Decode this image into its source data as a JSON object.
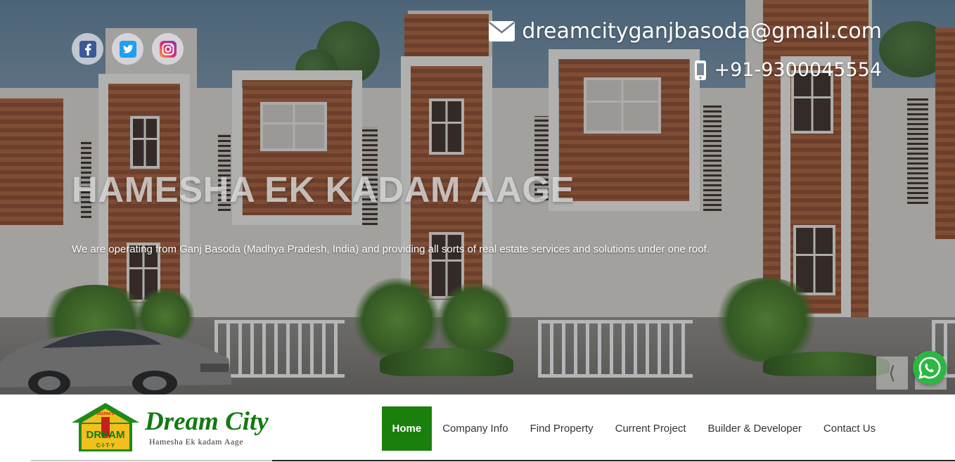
{
  "hero": {
    "social": [
      {
        "name": "facebook-icon",
        "color": "#3b5998"
      },
      {
        "name": "twitter-icon",
        "color": "#1da1f2"
      },
      {
        "name": "instagram-icon",
        "color": "#c13584"
      }
    ],
    "email": "dreamcityganjbasoda@gmail.com",
    "phone": "+91-9300045554",
    "title": "HAMESHA EK KADAM AAGE",
    "subtitle": "We are operating from Ganj Basoda (Madhya Pradesh, India) and providing all sorts of real estate services and solutions under one roof.",
    "prev_icon": "chevron-left-icon",
    "whatsapp_icon": "whatsapp-icon"
  },
  "logo": {
    "badge_top": "DEEPAK'S",
    "badge_main": "DREAM",
    "badge_bottom": "C·I·T·Y",
    "brand_name": "Dream City",
    "tagline": "Hamesha Ek kadam Aage"
  },
  "nav": {
    "items": [
      {
        "label": "Home",
        "active": true
      },
      {
        "label": "Company Info",
        "active": false
      },
      {
        "label": "Find Property",
        "active": false
      },
      {
        "label": "Current Project",
        "active": false
      },
      {
        "label": "Builder & Developer",
        "active": false
      },
      {
        "label": "Contact Us",
        "active": false
      }
    ]
  },
  "colors": {
    "accent": "#1a7f0d",
    "whatsapp": "#2bb741"
  }
}
